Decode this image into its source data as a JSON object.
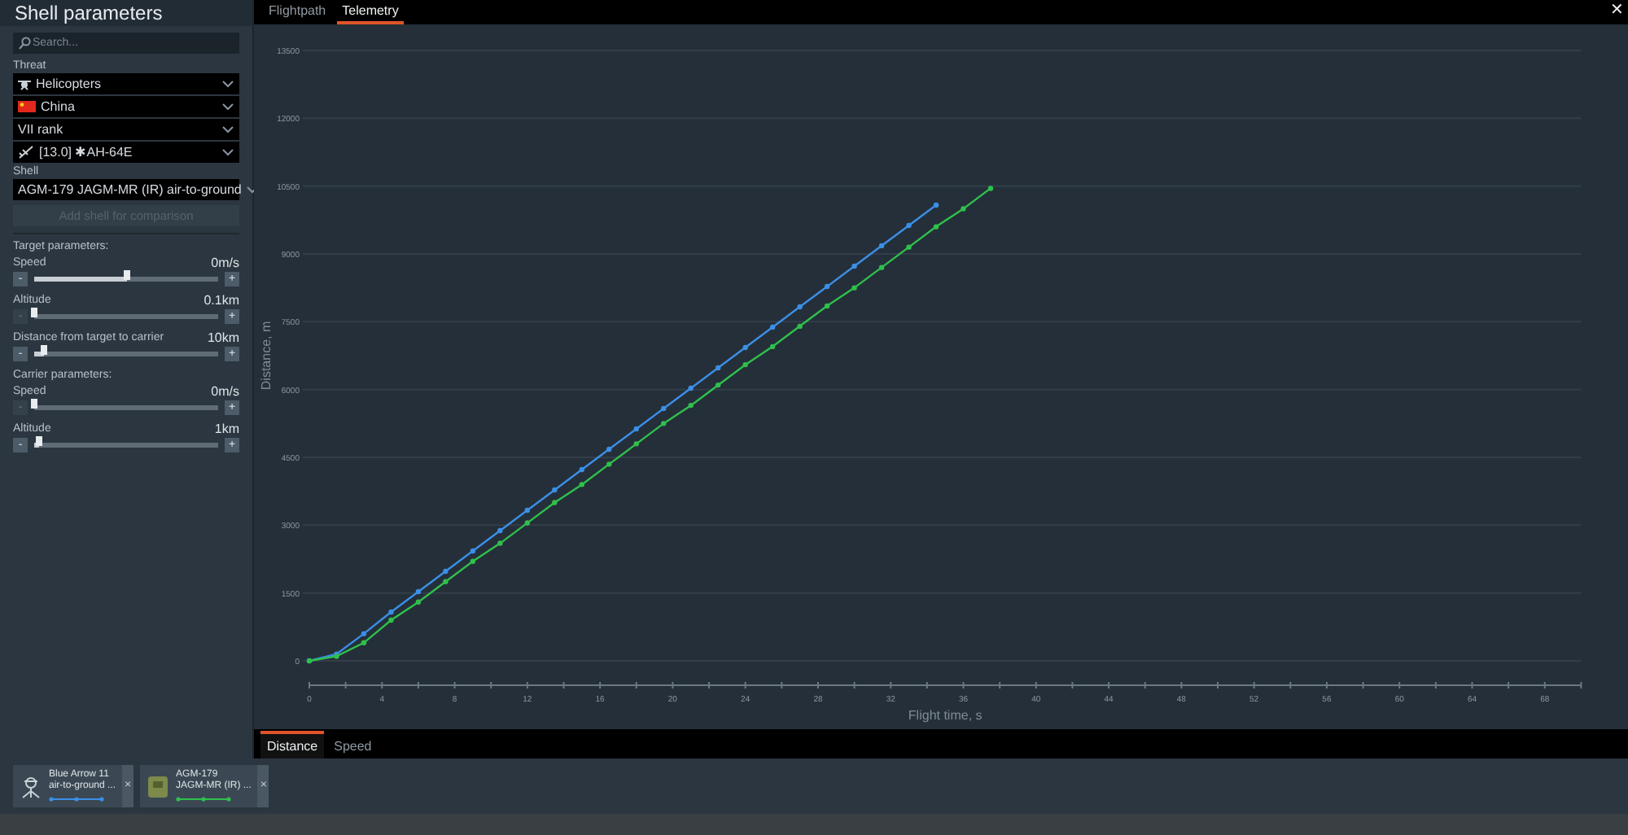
{
  "sidebar": {
    "title": "Shell parameters",
    "search": {
      "placeholder": "Search..."
    },
    "threat_label": "Threat",
    "threat_selects": [
      {
        "kind": "class",
        "value": "Helicopters"
      },
      {
        "kind": "country",
        "value": "China"
      },
      {
        "kind": "rank",
        "value": "VII rank"
      },
      {
        "kind": "vehicle",
        "value": "[13.0] ✱AH-64E"
      }
    ],
    "shell_label": "Shell",
    "shell_select": {
      "value": "AGM-179 JAGM-MR (IR) air-to-ground"
    },
    "add_button": {
      "label": "Add shell for comparison",
      "disabled": true
    },
    "groups": [
      {
        "title": "Target parameters:",
        "sliders": [
          {
            "label": "Speed",
            "reading": "0m/s",
            "level": 0.5,
            "decrease_disabled": false,
            "minus": "-",
            "plus": "+"
          },
          {
            "label": "Altitude",
            "reading": "0.1km",
            "level": 0.0,
            "decrease_disabled": true,
            "minus": "-",
            "plus": "+"
          },
          {
            "label": "Distance from target to carrier",
            "reading": "10km",
            "level": 0.05,
            "decrease_disabled": false,
            "minus": "-",
            "plus": "+"
          }
        ]
      },
      {
        "title": "Carrier parameters:",
        "sliders": [
          {
            "label": "Speed",
            "reading": "0m/s",
            "level": 0.0,
            "decrease_disabled": true,
            "minus": "-",
            "plus": "+"
          },
          {
            "label": "Altitude",
            "reading": "1km",
            "level": 0.03,
            "decrease_disabled": false,
            "minus": "-",
            "plus": "+"
          }
        ]
      }
    ]
  },
  "tabs": [
    {
      "label": "Flightpath",
      "selected": false
    },
    {
      "label": "Telemetry",
      "selected": true
    }
  ],
  "close": "✕",
  "chart_data": {
    "type": "line",
    "xlabel": "Flight time, s",
    "ylabel": "Distance, m",
    "x": [
      0,
      1.5,
      3,
      4.5,
      6,
      7.5,
      9,
      10.5,
      12,
      13.5,
      15,
      16.5,
      18,
      19.5,
      21,
      22.5,
      24,
      25.5,
      27,
      28.5,
      30,
      31.5,
      33,
      34.5,
      36,
      37.5
    ],
    "series": [
      {
        "color": "#3b8fe6",
        "marker": true,
        "values": [
          0,
          150,
          600,
          1080,
          1530,
          1980,
          2430,
          2880,
          3330,
          3780,
          4230,
          4680,
          5130,
          5580,
          6030,
          6480,
          6930,
          7380,
          7830,
          8280,
          8730,
          9180,
          9630,
          10080,
          null,
          null
        ]
      },
      {
        "color": "#2fc04c",
        "marker": true,
        "values": [
          0,
          100,
          400,
          900,
          1300,
          1750,
          2200,
          2600,
          3050,
          3500,
          3900,
          4350,
          4800,
          5250,
          5650,
          6100,
          6550,
          6950,
          7400,
          7850,
          8250,
          8700,
          9150,
          9600,
          10000,
          10450
        ]
      }
    ],
    "grid": true,
    "xlim": [
      0,
      70
    ],
    "ylim": [
      0,
      13500
    ],
    "xticks": [
      0,
      4,
      8,
      12,
      16,
      20,
      24,
      28,
      32,
      36,
      40,
      44,
      48,
      52,
      56,
      60,
      64,
      68
    ],
    "yticks": [
      0,
      1500,
      3000,
      4500,
      6000,
      7500,
      9000,
      10500,
      12000,
      13500
    ]
  },
  "chart_tabs": [
    {
      "label": "Distance",
      "selected": true
    },
    {
      "label": "Speed",
      "selected": false
    }
  ],
  "shell_cards": [
    {
      "kind": "missile",
      "line_1": "Blue Arrow 11",
      "line_2": "air-to-ground ...",
      "color": "#3b8fe6",
      "close": "×"
    },
    {
      "kind": "vehicle",
      "line_1": "AGM-179",
      "line_2": "JAGM-MR (IR) ...",
      "color": "#2fc04c",
      "close": "×"
    }
  ]
}
